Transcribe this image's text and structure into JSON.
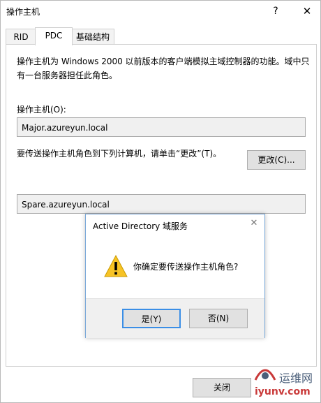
{
  "window": {
    "title": "操作主机",
    "help_glyph": "?",
    "close_glyph": "✕"
  },
  "tabs": [
    {
      "label": "RID",
      "active": false
    },
    {
      "label": "PDC",
      "active": true
    },
    {
      "label": "基础结构",
      "active": false
    }
  ],
  "pdc": {
    "description": "操作主机为 Windows 2000 以前版本的客户端模拟主域控制器的功能。域中只有一台服务器担任此角色。",
    "operations_master_label": "操作主机(O):",
    "operations_master_value": "Major.azureyun.local",
    "transfer_label": "要传送操作主机角色到下列计算机，请单击“更改”(T)。",
    "change_button": "更改(C)...",
    "target_value": "Spare.azureyun.local"
  },
  "footer": {
    "close_button": "关闭"
  },
  "dialog": {
    "title": "Active Directory 域服务",
    "close_glyph": "✕",
    "message": "你确定要传送操作主机角色?",
    "yes_button": "是(Y)",
    "no_button": "否(N)",
    "icon": "warning-icon"
  },
  "watermark": {
    "text_cn": "运维网",
    "url": "iyunv.com",
    "icon": "logo-icon"
  },
  "colors": {
    "accent_border": "#3a8ee6",
    "warning_fill": "#f7c325",
    "watermark_red": "#c93939"
  }
}
